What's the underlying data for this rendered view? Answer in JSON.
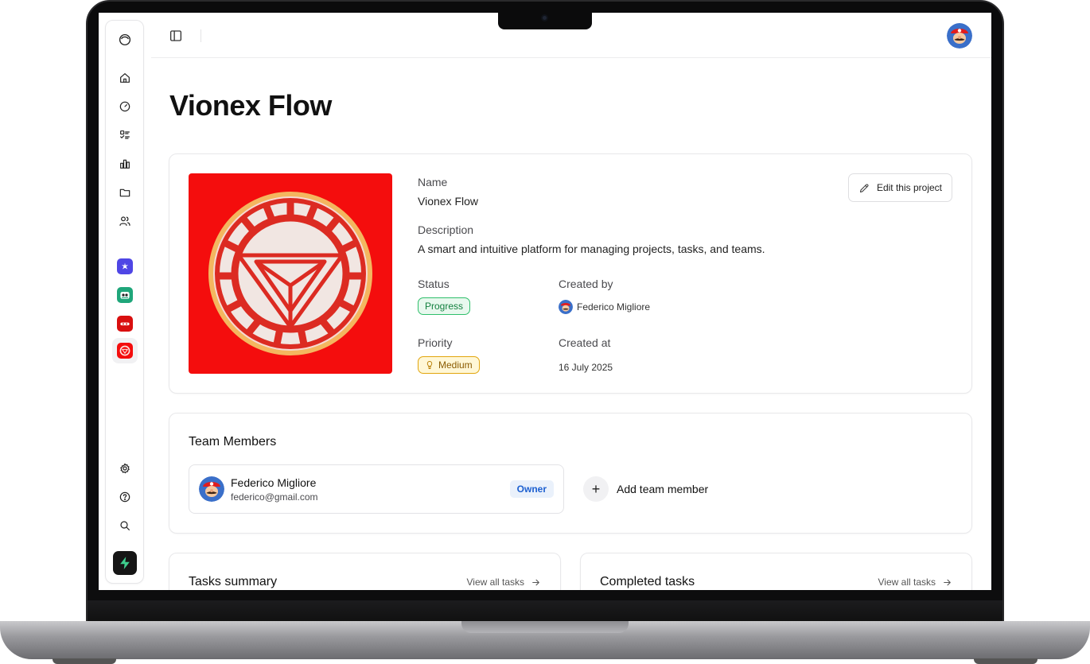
{
  "page": {
    "title": "Vionex Flow"
  },
  "sidebar": {
    "nav_icons": [
      "logo-icon",
      "home-icon",
      "dashboard-gauge-icon",
      "task-list-icon",
      "bar-chart-icon",
      "folder-icon",
      "users-icon"
    ],
    "projects": [
      {
        "icon": "star-app-icon",
        "color": "#4f46e5"
      },
      {
        "icon": "monster-app-icon",
        "color": "#1fa67a"
      },
      {
        "icon": "glasses-app-icon",
        "color": "#d90f0f"
      },
      {
        "icon": "reactor-app-icon",
        "color": "#f40d0d"
      }
    ],
    "bottom_icons": [
      "settings-icon",
      "help-icon",
      "search-icon",
      "bolt-logo-icon"
    ]
  },
  "project": {
    "name_label": "Name",
    "name_value": "Vionex Flow",
    "description_label": "Description",
    "description_value": "A smart and intuitive platform for managing projects, tasks, and teams.",
    "status_label": "Status",
    "status_value": "Progress",
    "created_by_label": "Created by",
    "created_by_value": "Federico Migliore",
    "priority_label": "Priority",
    "priority_value": "Medium",
    "created_at_label": "Created at",
    "created_at_value": "16 July 2025",
    "edit_button": "Edit this project",
    "image_color": "#f40d0d"
  },
  "team": {
    "title": "Team Members",
    "members": [
      {
        "name": "Federico Migliore",
        "email": "federico@gmail.com",
        "role": "Owner"
      }
    ],
    "add_label": "Add team member"
  },
  "tasks_summary": {
    "title": "Tasks summary",
    "link": "View all tasks"
  },
  "completed_tasks": {
    "title": "Completed tasks",
    "link": "View all tasks"
  }
}
